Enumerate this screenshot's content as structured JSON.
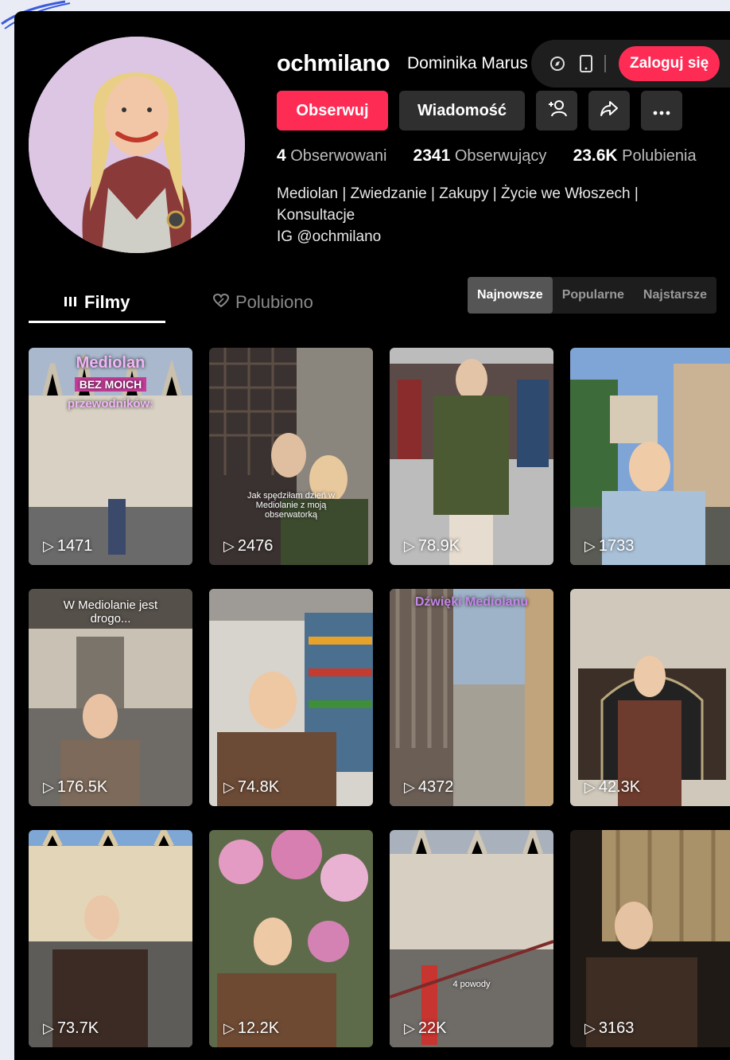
{
  "profile": {
    "username": "ochmilano",
    "display_name": "Dominika Marus",
    "follow_label": "Obserwuj",
    "message_label": "Wiadomość",
    "following_count": "4",
    "following_label": "Obserwowani",
    "followers_count": "2341",
    "followers_label": "Obserwujący",
    "likes_count": "23.6K",
    "likes_label": "Polubienia",
    "bio_line1": "Mediolan | Zwiedzanie | Zakupy | Życie we Włoszech |",
    "bio_line2": "Konsultacje",
    "bio_line3": "IG @ochmilano"
  },
  "header": {
    "login_label": "Zaloguj się"
  },
  "tabs": {
    "videos": "Filmy",
    "liked": "Polubiono"
  },
  "sort": {
    "newest": "Najnowsze",
    "popular": "Popularne",
    "oldest": "Najstarsze"
  },
  "videos": [
    {
      "views": "1471",
      "title1": "Mediolan",
      "title2": "BEZ MOICH",
      "title3": "przewodników:"
    },
    {
      "views": "2476",
      "caption": "Jak spędziłam dzień w Mediolanie z moją obserwatorką"
    },
    {
      "views": "78.9K"
    },
    {
      "views": "1733"
    },
    {
      "views": "176.5K",
      "caption": "W Mediolanie jest drogo..."
    },
    {
      "views": "74.8K"
    },
    {
      "views": "4372",
      "title": "Dźwięki Mediolanu"
    },
    {
      "views": "42.3K"
    },
    {
      "views": "73.7K"
    },
    {
      "views": "12.2K"
    },
    {
      "views": "22K",
      "caption": "4 powody"
    },
    {
      "views": "3163"
    }
  ],
  "colors": {
    "accent": "#fe2c55",
    "background": "#000000"
  }
}
